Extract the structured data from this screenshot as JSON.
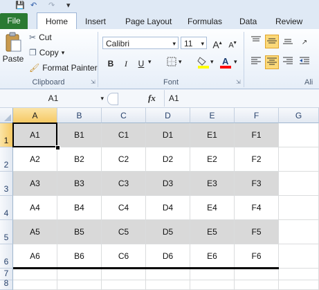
{
  "quick_access": {
    "save_icon": "save-icon",
    "undo_icon": "undo-icon",
    "redo_icon": "redo-icon",
    "customize_icon": "customize-icon"
  },
  "tabs": [
    {
      "label": "File"
    },
    {
      "label": "Home"
    },
    {
      "label": "Insert"
    },
    {
      "label": "Page Layout"
    },
    {
      "label": "Formulas"
    },
    {
      "label": "Data"
    },
    {
      "label": "Review"
    }
  ],
  "ribbon": {
    "clipboard": {
      "paste_label": "Paste",
      "cut_label": "Cut",
      "copy_label": "Copy",
      "format_painter_label": "Format Painter",
      "group_label": "Clipboard"
    },
    "font": {
      "font_name": "Calibri",
      "font_size": "11",
      "bold": "B",
      "italic": "I",
      "underline": "U",
      "grow": "A",
      "shrink": "A",
      "group_label": "Font",
      "fill_color": "#ffff00",
      "font_color": "#ff0000"
    },
    "alignment": {
      "group_label": "Ali"
    }
  },
  "formula_bar": {
    "name_box": "A1",
    "fx": "fx",
    "formula": "A1"
  },
  "sheet": {
    "columns": [
      "A",
      "B",
      "C",
      "D",
      "E",
      "F",
      "G"
    ],
    "rows": [
      "1",
      "2",
      "3",
      "4",
      "5",
      "6",
      "7",
      "8"
    ],
    "cells": [
      [
        "A1",
        "B1",
        "C1",
        "D1",
        "E1",
        "F1"
      ],
      [
        "A2",
        "B2",
        "C2",
        "D2",
        "E2",
        "F2"
      ],
      [
        "A3",
        "B3",
        "C3",
        "D3",
        "E3",
        "F3"
      ],
      [
        "A4",
        "B4",
        "C4",
        "D4",
        "E4",
        "F4"
      ],
      [
        "A5",
        "B5",
        "C5",
        "D5",
        "E5",
        "F5"
      ],
      [
        "A6",
        "B6",
        "C6",
        "D6",
        "E6",
        "F6"
      ]
    ],
    "selected_cell": "A1",
    "shade_color": "#d9d9d9"
  }
}
